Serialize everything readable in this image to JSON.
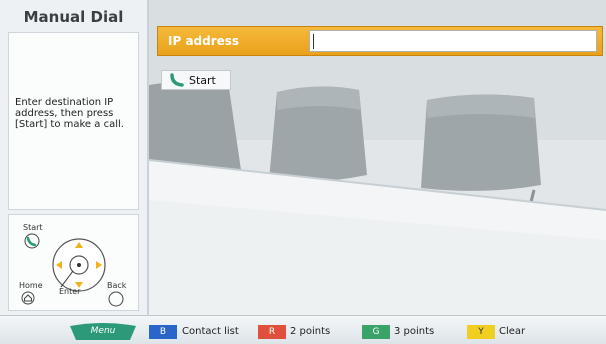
{
  "panel": {
    "title": "Manual Dial",
    "instructions": "Enter destination IP address, then press [Start] to make a call."
  },
  "remote": {
    "start_label": "Start",
    "home_label": "Home",
    "enter_label": "Enter",
    "back_label": "Back"
  },
  "ip_field": {
    "label": "IP address",
    "value": ""
  },
  "start_button": {
    "label": "Start"
  },
  "bottom_bar": {
    "menu": "Menu",
    "keys": [
      {
        "key": "B",
        "label": "Contact list",
        "color": "#2a66c9"
      },
      {
        "key": "R",
        "label": "2 points",
        "color": "#e0503a"
      },
      {
        "key": "G",
        "label": "3 points",
        "color": "#3aa36a"
      },
      {
        "key": "Y",
        "label": "Clear",
        "color": "#f1cf21"
      }
    ]
  },
  "colors": {
    "accent_orange": "#f0ad2f",
    "menu_green": "#2c9a78"
  }
}
